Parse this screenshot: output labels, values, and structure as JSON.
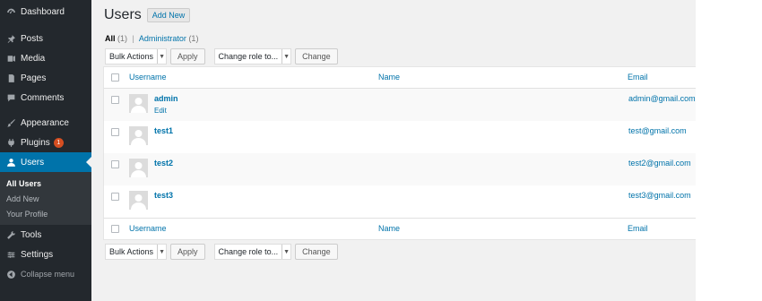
{
  "sidebar": {
    "items": [
      {
        "label": "Dashboard",
        "icon": "dashboard-icon"
      },
      {
        "label": "Posts",
        "icon": "pushpin-icon"
      },
      {
        "label": "Media",
        "icon": "media-icon"
      },
      {
        "label": "Pages",
        "icon": "pages-icon"
      },
      {
        "label": "Comments",
        "icon": "comments-icon"
      },
      {
        "label": "Appearance",
        "icon": "paintbrush-icon"
      },
      {
        "label": "Plugins",
        "icon": "plugins-icon",
        "badge": "1"
      },
      {
        "label": "Users",
        "icon": "users-icon"
      },
      {
        "label": "Tools",
        "icon": "wrench-icon"
      },
      {
        "label": "Settings",
        "icon": "settings-icon"
      }
    ],
    "submenu": [
      "All Users",
      "Add New",
      "Your Profile"
    ],
    "collapse_label": "Collapse menu"
  },
  "page": {
    "title": "Users",
    "add_new": "Add New"
  },
  "views": {
    "all_label": "All",
    "all_count": "(1)",
    "separator": "|",
    "admin_label": "Administrator",
    "admin_count": "(1)"
  },
  "actions": {
    "bulk_label": "Bulk Actions",
    "apply_label": "Apply",
    "role_label": "Change role to...",
    "change_label": "Change"
  },
  "table": {
    "columns": [
      "Username",
      "Name",
      "Email"
    ],
    "rows": [
      {
        "username": "admin",
        "name": "",
        "email": "admin@gmail.com",
        "action": "Edit"
      },
      {
        "username": "test1",
        "name": "",
        "email": "test@gmail.com"
      },
      {
        "username": "test2",
        "name": "",
        "email": "test2@gmail.com"
      },
      {
        "username": "test3",
        "name": "",
        "email": "test3@gmail.com"
      }
    ]
  },
  "colors": {
    "sidebar_bg": "#23282d",
    "accent": "#0073aa",
    "badge": "#d54e21",
    "content_bg": "#f1f1f1"
  }
}
